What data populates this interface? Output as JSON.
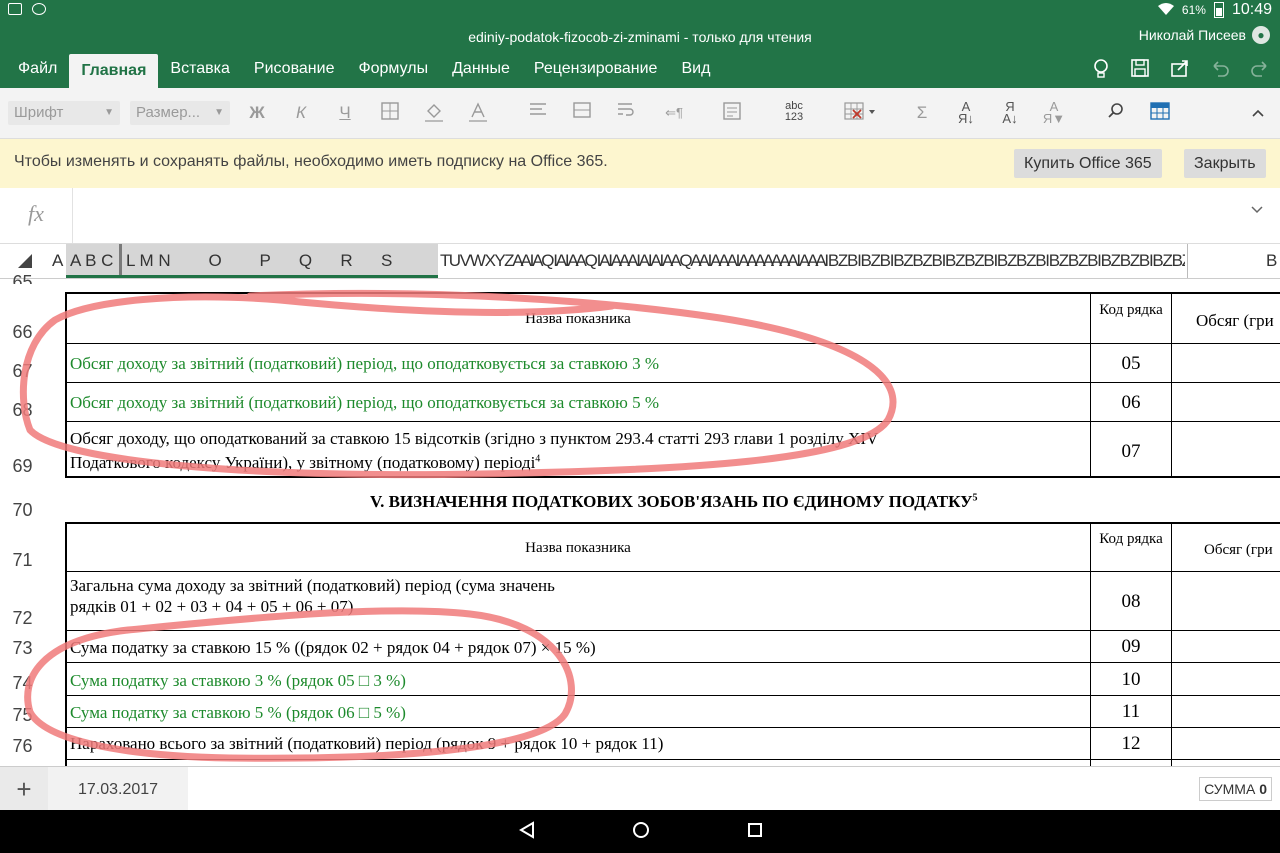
{
  "status_bar": {
    "battery": "61%",
    "time": "10:49"
  },
  "titlebar": {
    "title": "ediniy-podatok-fizocob-zi-zminami - только для чтения",
    "user": "Николай Писеев"
  },
  "menu": {
    "tabs": [
      "Файл",
      "Главная",
      "Вставка",
      "Рисование",
      "Формулы",
      "Данные",
      "Рецензирование",
      "Вид"
    ],
    "active": "Главная"
  },
  "toolbar": {
    "font_placeholder": "Шрифт",
    "size_placeholder": "Размер...",
    "bold": "Ж",
    "italic": "К",
    "underline": "Ч",
    "spell": "abc\n123"
  },
  "banner": {
    "message": "Чтобы изменять и сохранять файлы, необходимо иметь подписку на Office 365.",
    "buy_label": "Купить Office 365",
    "close_label": "Закрыть"
  },
  "formula_bar": {
    "fx": "fx",
    "value": ""
  },
  "columns": {
    "group1": "A B C",
    "group2": "L M N        O        P      Q      R      S",
    "rest": "T U V W X Y Z A A I A Q I A I A A Q I A I A A A I A I A I A A Q A A I A A A I A A A A A A A I A A A I B Z B I B Z B I B Z B Z B I B Z B Z B I B Z B Z B I B Z B Z B I B Z B Z B I B Z B Z B I B Z B Z B I B Z B Z M",
    "right": "B"
  },
  "rows": [
    "65",
    "66",
    "67",
    "68",
    "69",
    "70",
    "71",
    "72",
    "73",
    "74",
    "75",
    "76"
  ],
  "section4": {
    "header_name": "Назва показника",
    "header_code": "Код рядка",
    "header_amount": "Обсяг (гри",
    "rows": [
      {
        "text": "Обсяг доходу за звітний (податковий) період, що оподатковується за ставкою 3 %",
        "code": "05"
      },
      {
        "text": "Обсяг доходу за звітний (податковий) період, що оподатковується за ставкою 5 %",
        "code": "06"
      },
      {
        "text1": "Обсяг доходу, що оподаткований за ставкою 15 відсотків (згідно  з пунктом 293.4 статті 293 глави 1 розділу XIV",
        "text2": "Податкового кодексу України), у звітному (податковому) періоді",
        "sup": "4",
        "code": "07"
      }
    ]
  },
  "section5": {
    "title": "V.  ВИЗНАЧЕННЯ ПОДАТКОВИХ ЗОБОВ'ЯЗАНЬ ПО ЄДИНОМУ ПОДАТКУ",
    "title_sup": "5",
    "header_name": "Назва показника",
    "header_code": "Код рядка",
    "header_amount": "Обсяг (гри",
    "rows": [
      {
        "text1": "Загальна сума доходу за звітний (податковий) період (сума значень",
        "text2": "рядків 01 + 02 + 03 + 04 + 05 + 06 + 07)",
        "code": "08"
      },
      {
        "text": "Сума податку за ставкою 15 % ((рядок 02 + рядок 04 + рядок 07) × 15 %)",
        "code": "09"
      },
      {
        "text": "Сума податку за ставкою 3 % (рядок 05 □ 3 %)",
        "code": "10"
      },
      {
        "text": "Сума податку за ставкою 5 % (рядок 06 □ 5 %)",
        "code": "11"
      },
      {
        "text": "Нараховано всього за звітний (податковий) період (рядок 9 + рядок 10 + рядок 11)",
        "code": "12"
      }
    ]
  },
  "bottom": {
    "add": "+",
    "sheet": "17.03.2017",
    "sum_label": "СУММА",
    "sum_value": "0"
  },
  "annotation_color": "#f07a7a"
}
